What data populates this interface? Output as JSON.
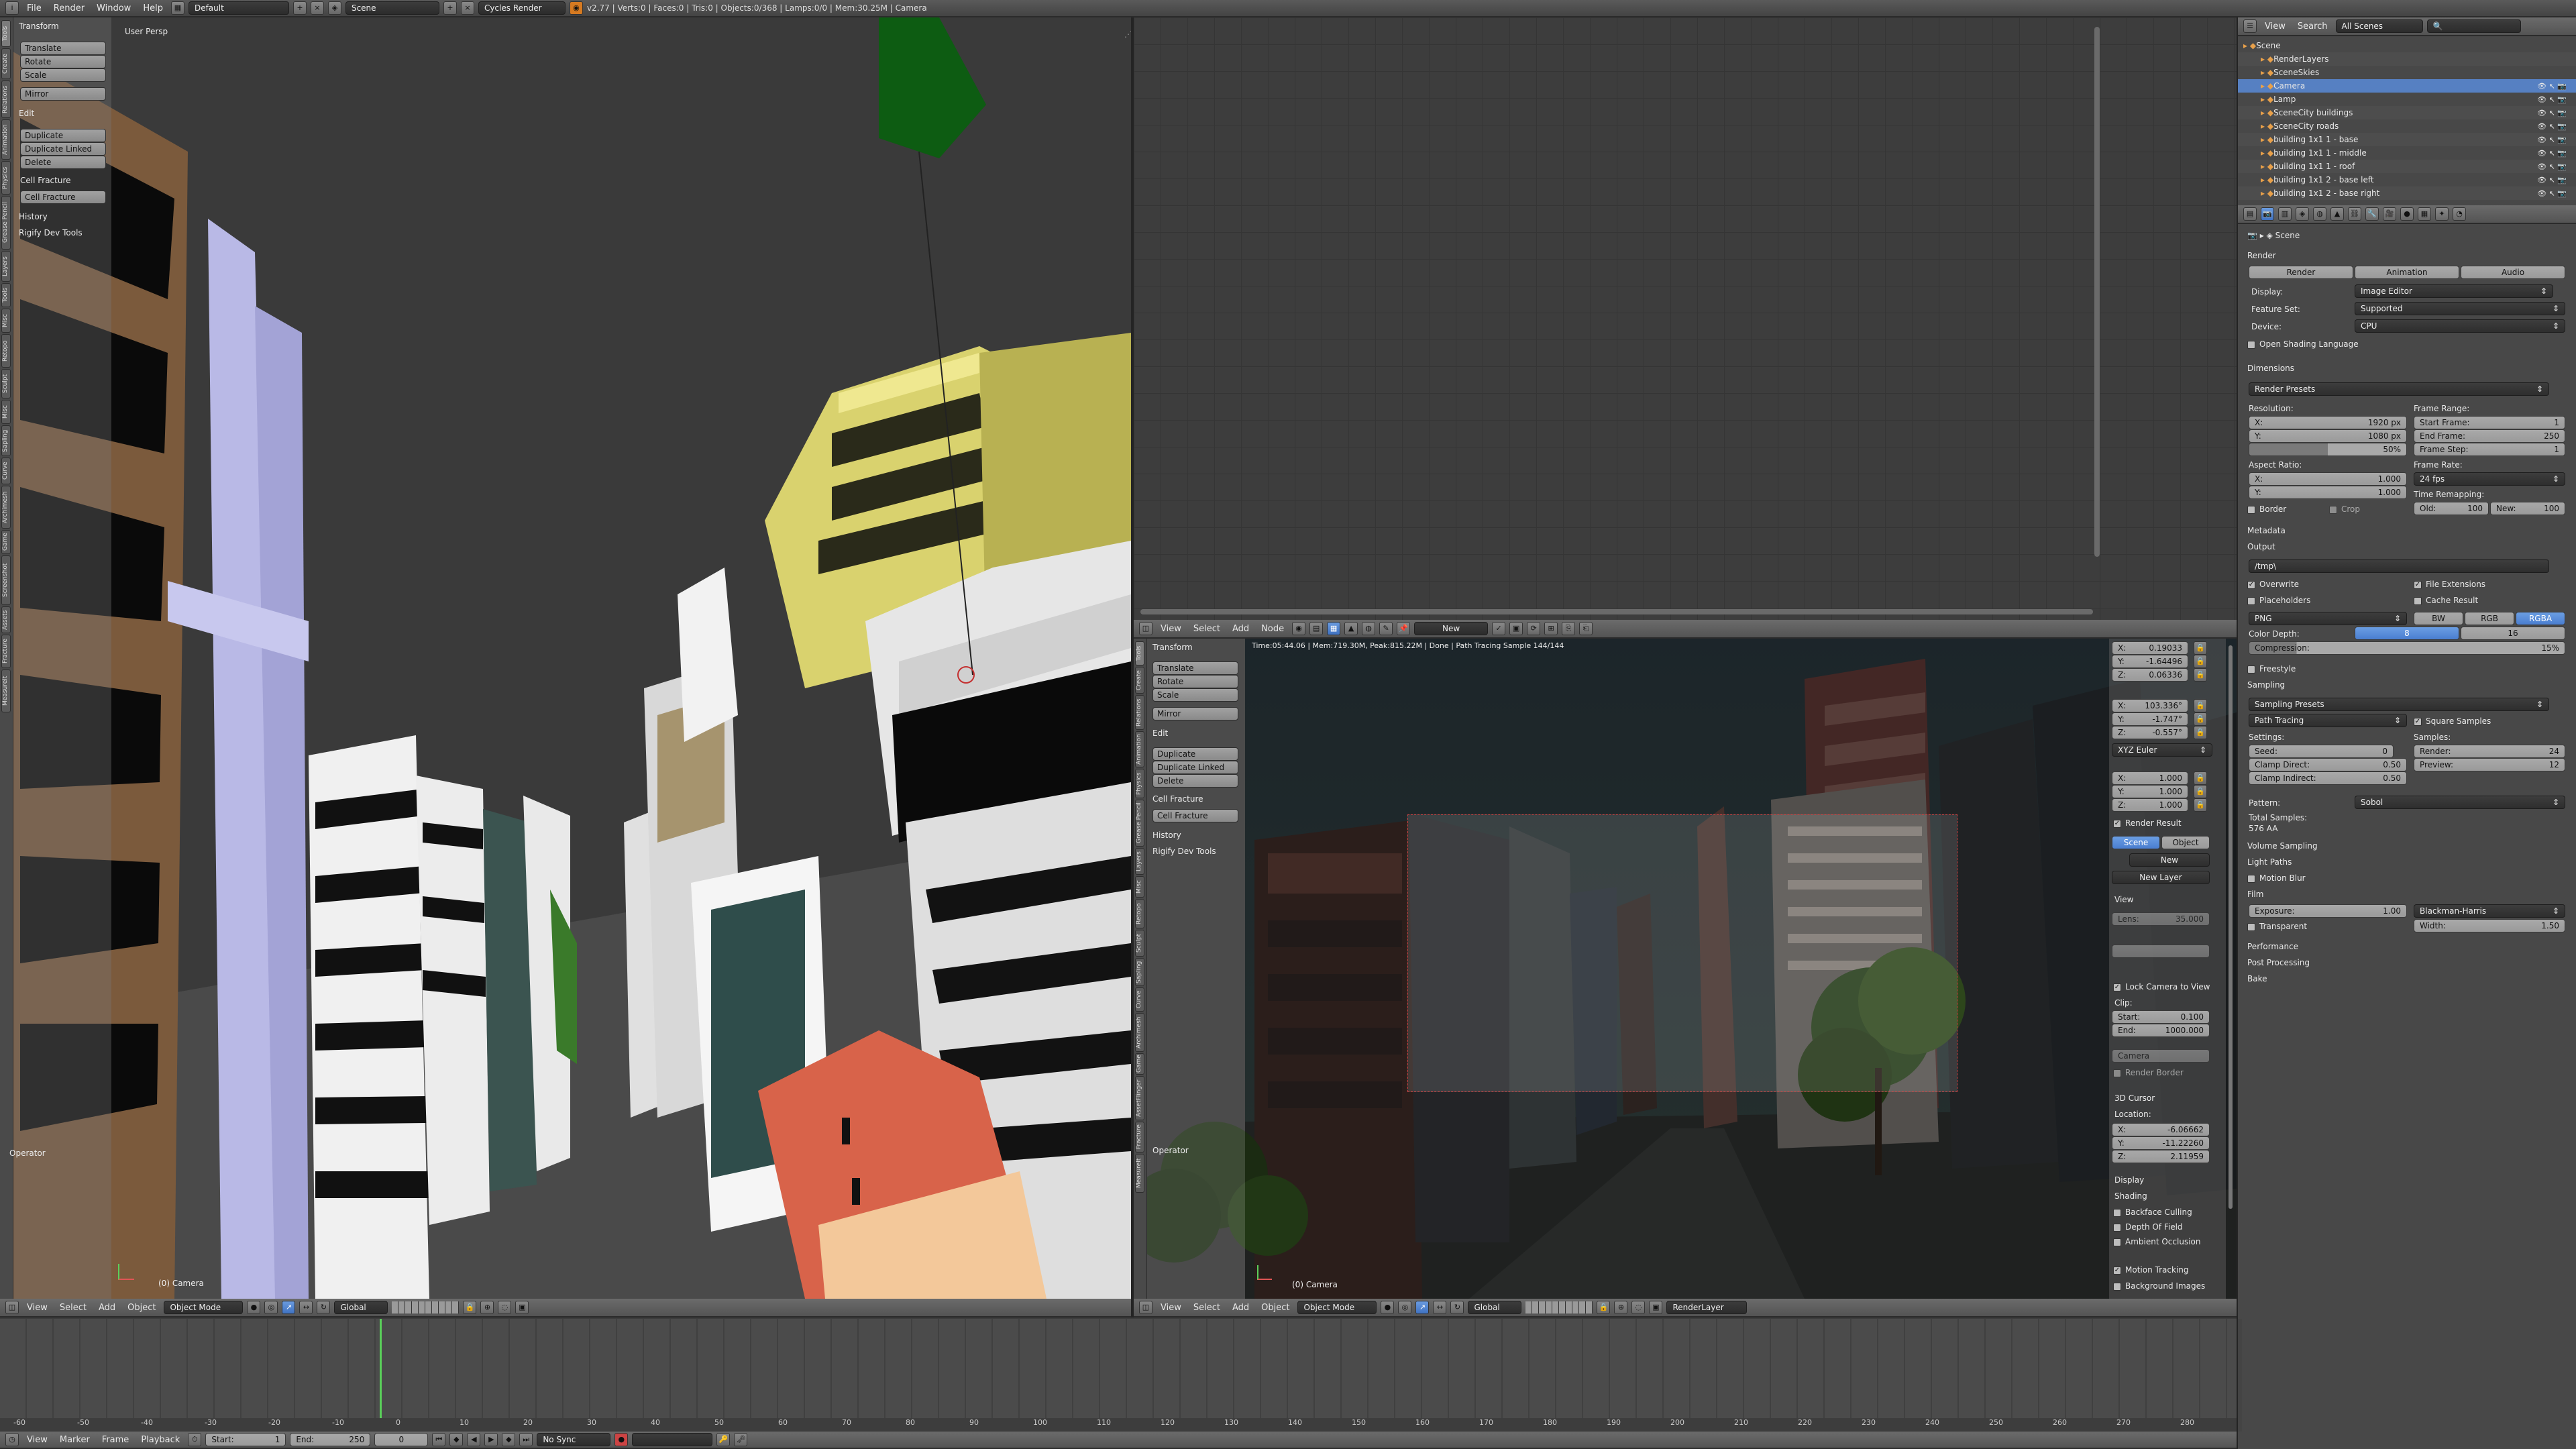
{
  "topbar": {
    "menus": [
      "File",
      "Render",
      "Window",
      "Help"
    ],
    "screen_layout": "Default",
    "scene": "Scene",
    "engine": "Cycles Render",
    "stats": "v2.77 | Verts:0 | Faces:0 | Tris:0 | Objects:0/368 | Lamps:0/0 | Mem:30.25M | Camera"
  },
  "viewport_left": {
    "label": "User Persp",
    "camera_label": "(0) Camera",
    "tool_tabs": [
      "Tools",
      "Create",
      "Relations",
      "Animation",
      "Physics",
      "Grease Pencil",
      "Grease Pencil",
      "Layers",
      "Tools",
      "Misc",
      "Retopo",
      "Sculpt",
      "Misc",
      "Sapling",
      "Curve",
      "Archimesh",
      "Game",
      "Screenshot",
      "Assets",
      "Fracture",
      "MeasureIt"
    ],
    "toolshelf": {
      "transform": "Transform",
      "translate": "Translate",
      "rotate": "Rotate",
      "scale": "Scale",
      "mirror": "Mirror",
      "edit": "Edit",
      "duplicate": "Duplicate",
      "duplicate_linked": "Duplicate Linked",
      "delete": "Delete",
      "cell_fracture_head": "Cell Fracture",
      "cell_fracture": "Cell Fracture",
      "history": "History",
      "rigify": "Rigify Dev Tools"
    },
    "operator": "Operator",
    "header": {
      "menus": [
        "View",
        "Select",
        "Add",
        "Object"
      ],
      "mode": "Object Mode",
      "orientation": "Global"
    }
  },
  "node_editor": {},
  "viewport_right": {
    "info": "Time:05:44.06 | Mem:719.30M, Peak:815.22M | Done | Path Tracing Sample 144/144",
    "camera_label": "(0) Camera",
    "header_top": {
      "menus": [
        "View",
        "Select",
        "Add",
        "Node"
      ],
      "new": "New"
    },
    "toolshelf": {
      "transform": "Transform",
      "translate": "Translate",
      "rotate": "Rotate",
      "scale": "Scale",
      "mirror": "Mirror",
      "edit": "Edit",
      "duplicate": "Duplicate",
      "duplicate_linked": "Duplicate Linked",
      "delete": "Delete",
      "cell_fracture_head": "Cell Fracture",
      "cell_fracture": "Cell Fracture",
      "history": "History",
      "rigify": "Rigify Dev Tools"
    },
    "operator": "Operator",
    "tabs": [
      "Tools",
      "Create",
      "Relations",
      "Animation",
      "Physics",
      "Grease Pencil",
      "Layers",
      "Misc",
      "Retopo",
      "Sculpt",
      "Sapling",
      "Curve",
      "Archimesh",
      "Game",
      "AssetFlinger",
      "Fracture",
      "MeasureIt"
    ],
    "header": {
      "menus": [
        "View",
        "Select",
        "Add",
        "Object"
      ],
      "mode": "Object Mode",
      "orientation": "Global",
      "render_layer": "RenderLayer"
    },
    "n_panel": {
      "loc_x": "X:",
      "loc_x_v": "0.19033",
      "loc_y": "Y:",
      "loc_y_v": "-1.64496",
      "loc_z": "Z:",
      "loc_z_v": "0.06336",
      "rot_x": "X:",
      "rot_x_v": "103.336°",
      "rot_y": "Y:",
      "rot_y_v": "-1.747°",
      "rot_z": "Z:",
      "rot_z_v": "-0.557°",
      "rot_mode": "XYZ Euler",
      "sc_x": "X:",
      "sc_x_v": "1.000",
      "sc_y": "Y:",
      "sc_y_v": "1.000",
      "sc_z": "Z:",
      "sc_z_v": "1.000",
      "render_result": "Render Result",
      "scene_btn": "Scene",
      "object_btn": "Object",
      "new_btn": "New",
      "new_layer": "New Layer",
      "view": "View",
      "lens": "Lens:",
      "lens_v": "35.000",
      "lock_camera": "Lock Camera to View",
      "clip": "Clip:",
      "start": "Start:",
      "start_v": "0.100",
      "end": "End:",
      "end_v": "1000.000",
      "camera_fld": "Camera",
      "render_border": "Render Border",
      "cursor3d": "3D Cursor",
      "location": "Location:",
      "cx": "X:",
      "cx_v": "-6.06662",
      "cy": "Y:",
      "cy_v": "-11.22260",
      "cz": "Z:",
      "cz_v": "2.11959",
      "display": "Display",
      "shading": "Shading",
      "backface": "Backface Culling",
      "dof": "Depth Of Field",
      "ao": "Ambient Occlusion",
      "motion_tracking": "Motion Tracking",
      "background_images": "Background Images"
    }
  },
  "outliner": {
    "header": {
      "view": "View",
      "search": "Search",
      "filter": "All Scenes"
    },
    "items": [
      {
        "name": "Scene",
        "indent": 0
      },
      {
        "name": "RenderLayers",
        "indent": 1
      },
      {
        "name": "SceneSkies",
        "indent": 1
      },
      {
        "name": "Camera",
        "indent": 1
      },
      {
        "name": "Lamp",
        "indent": 1
      },
      {
        "name": "SceneCity buildings",
        "indent": 1
      },
      {
        "name": "SceneCity roads",
        "indent": 1
      },
      {
        "name": "building 1x1 1 - base",
        "indent": 1
      },
      {
        "name": "building 1x1 1 - middle",
        "indent": 1
      },
      {
        "name": "building 1x1 1 - roof",
        "indent": 1
      },
      {
        "name": "building 1x1 2 - base left",
        "indent": 1
      },
      {
        "name": "building 1x1 2 - base right",
        "indent": 1
      }
    ]
  },
  "properties": {
    "scene": "Scene",
    "render": "Render",
    "render_btn": "Render",
    "animation_btn": "Animation",
    "audio_btn": "Audio",
    "display": "Display:",
    "display_v": "Image Editor",
    "feature_set": "Feature Set:",
    "feature_set_v": "Supported",
    "device": "Device:",
    "device_v": "CPU",
    "osl": "Open Shading Language",
    "dimensions": "Dimensions",
    "render_presets": "Render Presets",
    "resolution": "Resolution:",
    "res_x": "X:",
    "res_x_v": "1920 px",
    "res_y": "Y:",
    "res_y_v": "1080 px",
    "res_pct": "50%",
    "frame_range": "Frame Range:",
    "start_frame": "Start Frame:",
    "start_frame_v": "1",
    "end_frame": "End Frame:",
    "end_frame_v": "250",
    "frame_step": "Frame Step:",
    "frame_step_v": "1",
    "aspect": "Aspect Ratio:",
    "asp_x": "X:",
    "asp_x_v": "1.000",
    "asp_y": "Y:",
    "asp_y_v": "1.000",
    "frame_rate": "Frame Rate:",
    "fps": "24 fps",
    "time_remap": "Time Remapping:",
    "old": "Old:",
    "old_v": "100",
    "new": "New:",
    "new_v": "100",
    "border": "Border",
    "crop": "Crop",
    "metadata": "Metadata",
    "output": "Output",
    "output_path": "/tmp\\",
    "overwrite": "Overwrite",
    "file_ext": "File Extensions",
    "placeholders": "Placeholders",
    "cache_result": "Cache Result",
    "format": "PNG",
    "bw": "BW",
    "rgb": "RGB",
    "rgba": "RGBA",
    "color_depth": "Color Depth:",
    "depth8": "8",
    "depth16": "16",
    "compression": "Compression:",
    "compression_v": "15%",
    "freestyle": "Freestyle",
    "sampling": "Sampling",
    "sampling_presets": "Sampling Presets",
    "path_tracing": "Path Tracing",
    "square_samples": "Square Samples",
    "settings": "Settings:",
    "samples": "Samples:",
    "seed": "Seed:",
    "seed_v": "0",
    "clamp_direct": "Clamp Direct:",
    "clamp_direct_v": "0.50",
    "clamp_indirect": "Clamp Indirect:",
    "clamp_indirect_v": "0.50",
    "s_render": "Render:",
    "s_render_v": "24",
    "s_preview": "Preview:",
    "s_preview_v": "12",
    "pattern": "Pattern:",
    "pattern_v": "Sobol",
    "total_samples": "Total Samples:",
    "total_samples_v": "576 AA",
    "volume_sampling": "Volume Sampling",
    "light_paths": "Light Paths",
    "motion_blur": "Motion Blur",
    "film": "Film",
    "exposure": "Exposure:",
    "exposure_v": "1.00",
    "filter": "Blackman-Harris",
    "transparent": "Transparent",
    "width": "Width:",
    "width_v": "1.50",
    "performance": "Performance",
    "post_processing": "Post Processing",
    "bake": "Bake"
  },
  "timeline": {
    "ruler": [
      "-60",
      "-50",
      "-40",
      "-30",
      "-20",
      "-10",
      "0",
      "10",
      "20",
      "30",
      "40",
      "50",
      "60",
      "70",
      "80",
      "90",
      "100",
      "110",
      "120",
      "130",
      "140",
      "150",
      "160",
      "170",
      "180",
      "190",
      "200",
      "210",
      "220",
      "230",
      "240",
      "250",
      "260",
      "270",
      "280"
    ],
    "menus": [
      "View",
      "Marker",
      "Frame",
      "Playback"
    ],
    "start": "Start:",
    "start_v": "1",
    "end": "End:",
    "end_v": "250",
    "current": "0",
    "sync": "No Sync"
  },
  "colors": {
    "bg": "#3d3d3d",
    "header": "#5f5f5f",
    "selected": "#5680c2",
    "green": "#0d5c12",
    "camera_red": "#c42f2f"
  }
}
